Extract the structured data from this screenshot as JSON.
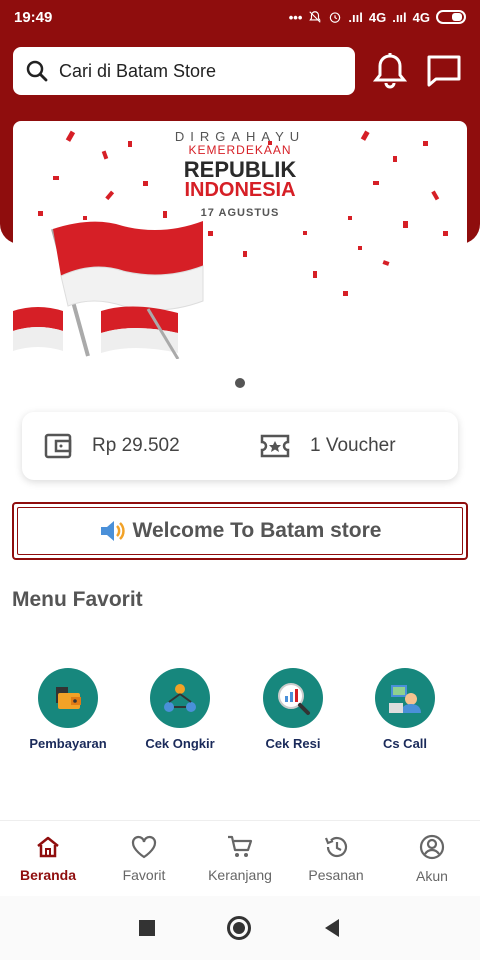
{
  "status_bar": {
    "time": "19:49",
    "signal_text_1": "4G",
    "signal_text_2": "4G"
  },
  "search": {
    "placeholder": "Cari di Batam Store"
  },
  "banner": {
    "line1": "DIRGAHAYU",
    "line2": "KEMERDEKAAN",
    "line3": "REPUBLIK",
    "line4": "INDONESIA",
    "line5": "17 AGUSTUS"
  },
  "wallet": {
    "balance": "Rp 29.502",
    "voucher": "1 Voucher"
  },
  "welcome": {
    "text": "Welcome To Batam store"
  },
  "menu_favorit": {
    "title": "Menu Favorit",
    "items": [
      {
        "label": "Pembayaran",
        "icon": "wallet-payment-icon"
      },
      {
        "label": "Cek Ongkir",
        "icon": "network-shipping-icon"
      },
      {
        "label": "Cek Resi",
        "icon": "chart-search-icon"
      },
      {
        "label": "Cs Call",
        "icon": "customer-service-icon"
      }
    ]
  },
  "bottom_nav": {
    "items": [
      {
        "label": "Beranda",
        "icon": "home-icon",
        "active": true
      },
      {
        "label": "Favorit",
        "icon": "heart-icon",
        "active": false
      },
      {
        "label": "Keranjang",
        "icon": "cart-icon",
        "active": false
      },
      {
        "label": "Pesanan",
        "icon": "history-icon",
        "active": false
      },
      {
        "label": "Akun",
        "icon": "account-icon",
        "active": false
      }
    ]
  },
  "colors": {
    "primary": "#8f0d0d",
    "teal": "#17877d",
    "menu_text": "#1a2a5a"
  }
}
